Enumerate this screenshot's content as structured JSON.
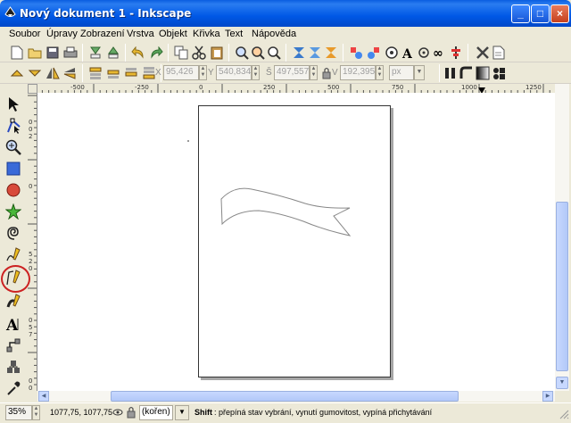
{
  "window": {
    "title": "Nový dokument 1 - Inkscape",
    "controls": [
      "_",
      "□",
      "×"
    ]
  },
  "menu": [
    {
      "label": "Soubor"
    },
    {
      "label": "Úpravy"
    },
    {
      "label": "Zobrazení"
    },
    {
      "label": "Vrstva"
    },
    {
      "label": "Objekt"
    },
    {
      "label": "Křivka"
    },
    {
      "label": "Text"
    },
    {
      "label": "Nápověda"
    }
  ],
  "toolbar": {
    "x_label": "X",
    "x_value": "95,426",
    "y_label": "Y",
    "y_value": "540,834",
    "w_label": "Š",
    "w_value": "497,557",
    "h_label": "V",
    "h_value": "192,395",
    "unit": "px"
  },
  "ruler": {
    "h_ticks": [
      "-500",
      "-250",
      "0",
      "250",
      "500",
      "750",
      "1000",
      "1250"
    ],
    "v_ticks": [
      "0",
      "0",
      "2",
      "0",
      "5",
      "2",
      "0",
      "0",
      "5",
      "7",
      "0",
      "0",
      "1"
    ]
  },
  "statusbar": {
    "zoom": "35%",
    "coords": "1077,75, 1077,75",
    "layer": "(kořen)",
    "hint_key": "Shift",
    "hint_text": ": přepíná stav vybrání, vynutí gumovitost, vypíná přichytávání"
  },
  "colors": {
    "titlebar": "#0058e6",
    "highlight_circle": "#cc2222"
  }
}
